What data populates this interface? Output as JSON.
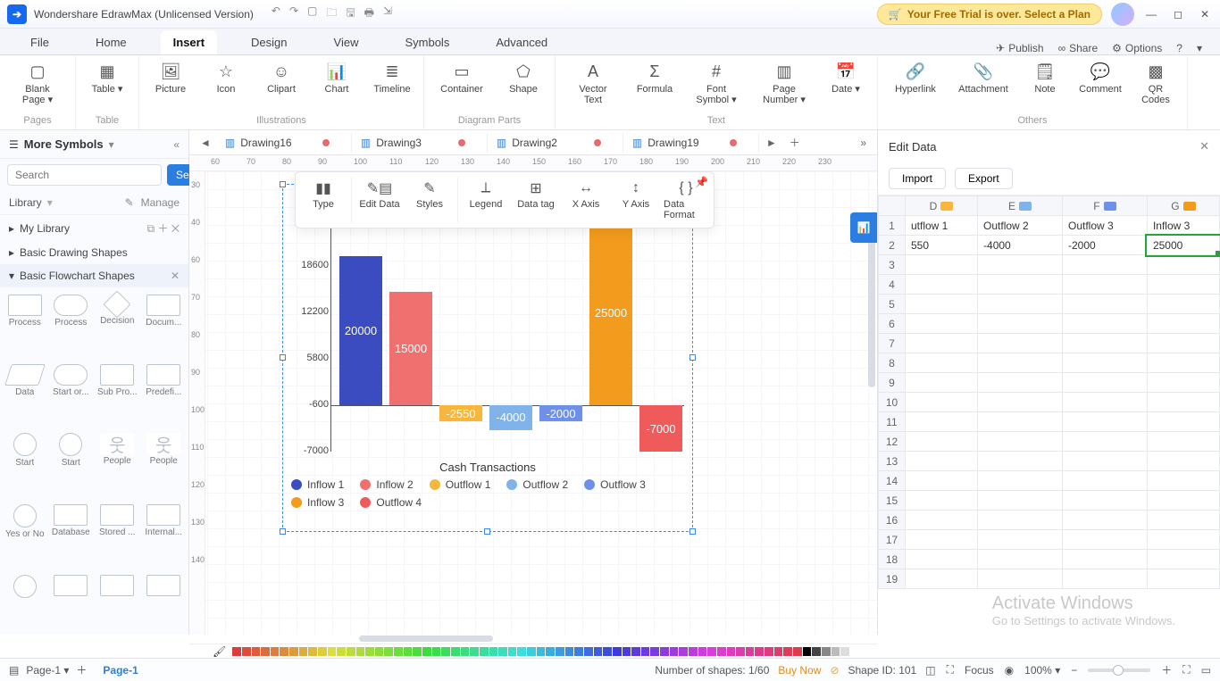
{
  "app": {
    "title": "Wondershare EdrawMax (Unlicensed Version)"
  },
  "trial_banner": "Your Free Trial is over. Select a Plan",
  "menu_tabs": [
    "File",
    "Home",
    "Insert",
    "Design",
    "View",
    "Symbols",
    "Advanced"
  ],
  "menu_active": "Insert",
  "menu_right": {
    "publish": "Publish",
    "share": "Share",
    "options": "Options"
  },
  "ribbon": {
    "pages": {
      "items": [
        {
          "l": "Blank\nPage",
          "dd": true
        }
      ],
      "label": "Pages"
    },
    "table": {
      "items": [
        {
          "l": "Table",
          "dd": true
        }
      ],
      "label": "Table"
    },
    "illus": {
      "items": [
        {
          "l": "Picture"
        },
        {
          "l": "Icon"
        },
        {
          "l": "Clipart"
        },
        {
          "l": "Chart"
        },
        {
          "l": "Timeline"
        }
      ],
      "label": "Illustrations"
    },
    "diag": {
      "items": [
        {
          "l": "Container"
        },
        {
          "l": "Shape"
        }
      ],
      "label": "Diagram Parts"
    },
    "text": {
      "items": [
        {
          "l": "Vector\nText"
        },
        {
          "l": "Formula"
        },
        {
          "l": "Font\nSymbol",
          "dd": true
        },
        {
          "l": "Page\nNumber",
          "dd": true
        },
        {
          "l": "Date",
          "dd": true
        }
      ],
      "label": "Text"
    },
    "others": {
      "items": [
        {
          "l": "Hyperlink"
        },
        {
          "l": "Attachment"
        },
        {
          "l": "Note"
        },
        {
          "l": "Comment"
        },
        {
          "l": "QR\nCodes"
        }
      ],
      "label": "Others"
    }
  },
  "more_symbols": "More Symbols",
  "search_placeholder": "Search",
  "search_btn": "Search",
  "library_label": "Library",
  "manage_label": "Manage",
  "cat_mylib": "My Library",
  "cat_basic": "Basic Drawing Shapes",
  "cat_flow": "Basic Flowchart Shapes",
  "shapes": [
    "Process",
    "Process",
    "Decision",
    "Docum...",
    "Data",
    "Start or...",
    "Sub Pro...",
    "Predefi...",
    "Start",
    "Start",
    "People",
    "People",
    "Yes or No",
    "Database",
    "Stored ...",
    "Internal..."
  ],
  "doc_tabs": [
    {
      "name": "Drawing16",
      "dirty": true
    },
    {
      "name": "Drawing3",
      "dirty": true
    },
    {
      "name": "Drawing2",
      "dirty": true
    },
    {
      "name": "Drawing19",
      "dirty": true
    }
  ],
  "float_tb": [
    "Type",
    "Edit Data",
    "Styles",
    "Legend",
    "Data tag",
    "X Axis",
    "Y Axis",
    "Data Format"
  ],
  "chart_data": {
    "type": "bar",
    "title": "Cash Transactions",
    "yticks": [
      18600,
      12200,
      5800,
      -600,
      -7000
    ],
    "baseline": -600,
    "series": [
      {
        "name": "Inflow 1",
        "value": 20000,
        "color": "#3b4cc0"
      },
      {
        "name": "Inflow 2",
        "value": 15000,
        "color": "#f0706f"
      },
      {
        "name": "Outflow 1",
        "value": -2550,
        "color": "#f6b73c"
      },
      {
        "name": "Outflow 2",
        "value": -4000,
        "color": "#7fb3ea"
      },
      {
        "name": "Outflow 3",
        "value": -2000,
        "color": "#6f90e8"
      },
      {
        "name": "Inflow 3",
        "value": 25000,
        "color": "#f39b1c"
      },
      {
        "name": "Outflow 4",
        "value": -7000,
        "color": "#ef5a5a"
      }
    ],
    "legend_order": [
      "Inflow 1",
      "Inflow 2",
      "Outflow 1",
      "Outflow 2",
      "Outflow 3",
      "Inflow 3",
      "Outflow 4"
    ]
  },
  "edit_panel": {
    "title": "Edit Data",
    "import": "Import",
    "export": "Export",
    "cols": [
      {
        "h": "D",
        "sw": "#f6b73c",
        "label": "utflow 1"
      },
      {
        "h": "E",
        "sw": "#7fb3ea",
        "label": "Outflow 2"
      },
      {
        "h": "F",
        "sw": "#6f90e8",
        "label": "Outflow 3"
      },
      {
        "h": "G",
        "sw": "#f39b1c",
        "label": "Inflow 3"
      }
    ],
    "row2": [
      "550",
      "-4000",
      "-2000",
      "25000"
    ],
    "selected_cell": "G2"
  },
  "status": {
    "page_tab": "Page-1",
    "page_label": "Page-1",
    "shapes": "Number of shapes: 1/60",
    "buy": "Buy Now",
    "shapeid": "Shape ID: 101",
    "focus": "Focus",
    "zoom": "100%"
  },
  "ruler_h": [
    60,
    70,
    80,
    90,
    100,
    110,
    120,
    130,
    140,
    150,
    160,
    170,
    180,
    190,
    200,
    210,
    220,
    230
  ],
  "ruler_v": [
    30,
    40,
    60,
    70,
    80,
    90,
    100,
    110,
    120,
    130,
    140
  ],
  "watermark": {
    "l1": "Activate Windows",
    "l2": "Go to Settings to activate Windows."
  }
}
